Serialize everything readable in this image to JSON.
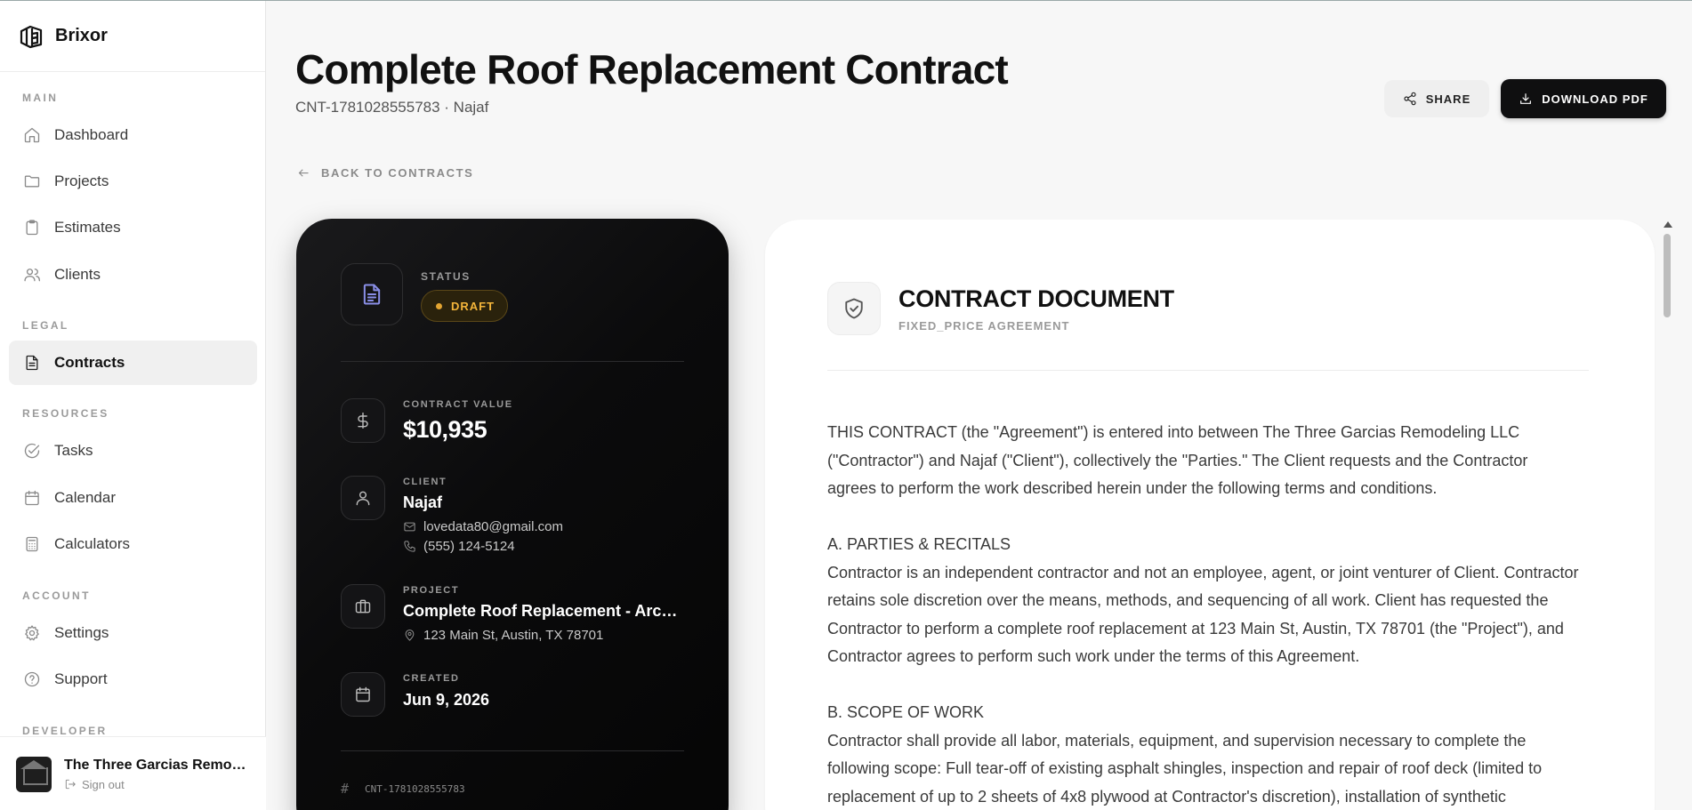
{
  "brand": {
    "name": "Brixor"
  },
  "sidebar": {
    "sections": [
      {
        "label": "MAIN"
      },
      {
        "label": "LEGAL"
      },
      {
        "label": "RESOURCES"
      },
      {
        "label": "ACCOUNT"
      },
      {
        "label": "DEVELOPER"
      }
    ],
    "items": [
      {
        "label": "Dashboard",
        "icon": "home-icon"
      },
      {
        "label": "Projects",
        "icon": "folder-icon"
      },
      {
        "label": "Estimates",
        "icon": "clipboard-icon"
      },
      {
        "label": "Clients",
        "icon": "users-icon"
      },
      {
        "label": "Contracts",
        "icon": "file-text-icon",
        "active": true
      },
      {
        "label": "Tasks",
        "icon": "check-circle-icon"
      },
      {
        "label": "Calendar",
        "icon": "calendar-icon"
      },
      {
        "label": "Calculators",
        "icon": "calculator-icon"
      },
      {
        "label": "Settings",
        "icon": "gear-icon"
      },
      {
        "label": "Support",
        "icon": "help-circle-icon"
      }
    ],
    "user": {
      "name": "The Three Garcias Remodeling LLC",
      "signout": "Sign out"
    }
  },
  "header": {
    "title": "Complete Roof Replacement Contract",
    "subtitle": "CNT-1781028555783 · Najaf",
    "share_label": "SHARE",
    "download_label": "DOWNLOAD PDF",
    "back_label": "BACK TO CONTRACTS"
  },
  "summary": {
    "status_label": "STATUS",
    "status_value": "DRAFT",
    "value_label": "CONTRACT VALUE",
    "value": "$10,935",
    "client_label": "CLIENT",
    "client_name": "Najaf",
    "client_email": "lovedata80@gmail.com",
    "client_phone": "(555) 124-5124",
    "project_label": "PROJECT",
    "project_name": "Complete Roof Replacement - Architectural Shingles",
    "project_address": "123 Main St, Austin, TX 78701",
    "created_label": "CREATED",
    "created_date": "Jun 9, 2026",
    "ref_hash": "#",
    "ref": "CNT-1781028555783"
  },
  "document": {
    "title": "CONTRACT DOCUMENT",
    "subtitle": "FIXED_PRICE AGREEMENT",
    "intro_1": "THIS CONTRACT (the \"Agreement\") is entered into between The Three Garcias Remodeling LLC",
    "intro_2": "(\"Contractor\") and Najaf (\"Client\"), collectively the \"Parties.\" The Client requests and the Contractor",
    "intro_3": "agrees to perform the work described herein under the following terms and conditions.",
    "a_heading": "A. PARTIES & RECITALS",
    "a_1": "Contractor is an independent contractor and not an employee, agent, or joint venturer of Client. Contractor",
    "a_2": "retains sole discretion over the means, methods, and sequencing of all work. Client has requested the",
    "a_3": "Contractor to perform a complete roof replacement at 123 Main St, Austin, TX 78701 (the \"Project\"), and",
    "a_4": "Contractor agrees to perform such work under the terms of this Agreement.",
    "b_heading": "B. SCOPE OF WORK",
    "b_1": "Contractor shall provide all labor, materials, equipment, and supervision necessary to complete the",
    "b_2": "following scope: Full tear-off of existing asphalt shingles, inspection and repair of roof deck (limited to",
    "b_3": "replacement of up to 2 sheets of 4x8 plywood at Contractor's discretion), installation of synthetic"
  },
  "colors": {
    "accent": "#0f0f10",
    "status": "#f2b43a",
    "doc_icon": "#8a8fe8"
  }
}
